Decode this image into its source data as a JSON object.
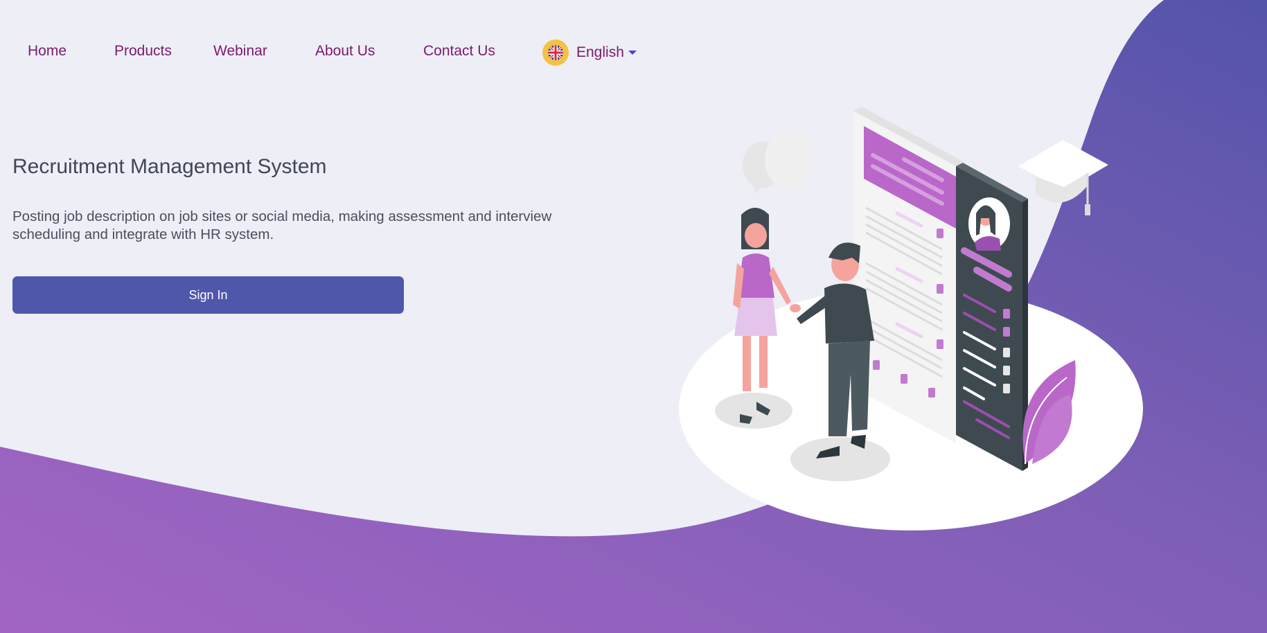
{
  "nav": {
    "items": [
      {
        "label": "Home"
      },
      {
        "label": "Products"
      },
      {
        "label": "Webinar"
      },
      {
        "label": "About Us"
      },
      {
        "label": "Contact Us"
      }
    ],
    "language": {
      "label": "English",
      "icon": "uk-flag-icon"
    }
  },
  "hero": {
    "title": "Recruitment Management System",
    "description": "Posting job description on job sites or social media, making assessment and interview scheduling and integrate with HR system.",
    "signin_label": "Sign In"
  },
  "colors": {
    "background": "#eeeef7",
    "nav_text": "#7a1a6b",
    "button": "#4f57ab",
    "wave_start": "#a365c4",
    "wave_end": "#5454aa",
    "accent_purple": "#b967c9",
    "dark_slate": "#3e4a50"
  }
}
